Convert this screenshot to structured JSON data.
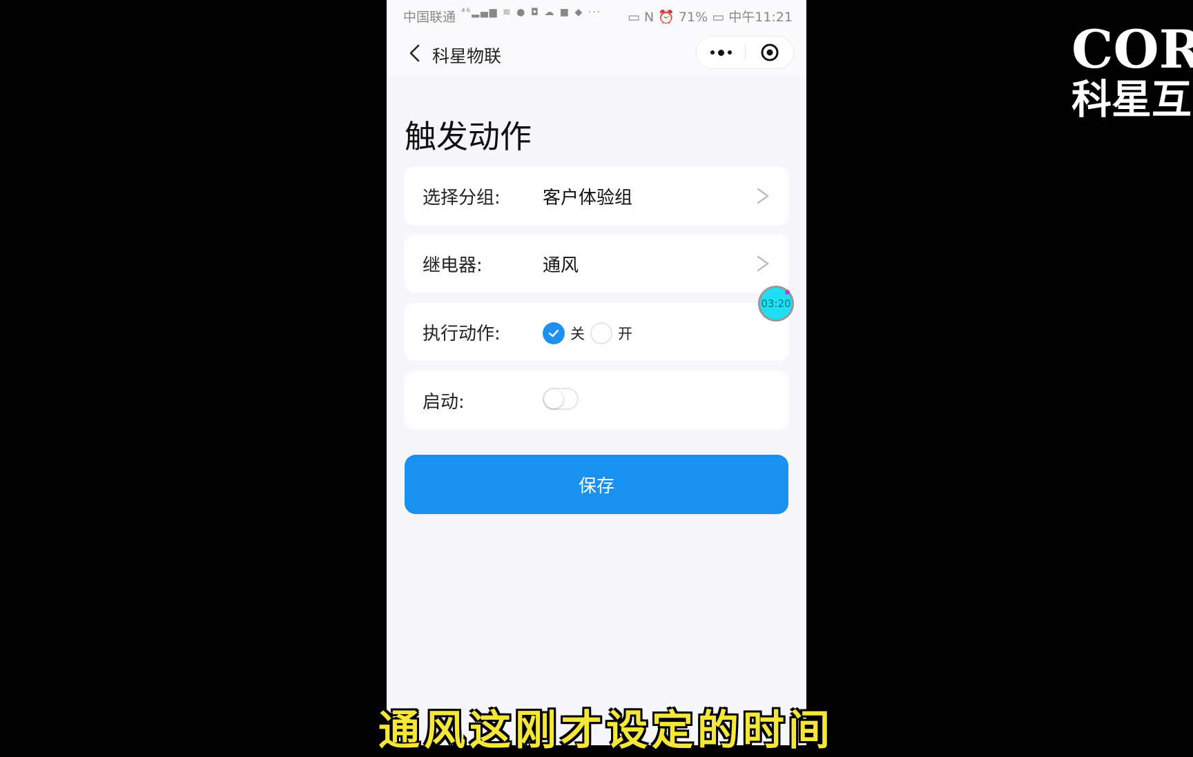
{
  "status_bar": {
    "carrier": "中国联通",
    "icons": "⁴⁶▂▄▆ ≋ ● ◘ ☁ ■ ◆ ···",
    "right": "▭ N ⏰ 71% ▭ 中午11:21"
  },
  "nav": {
    "title": "科星物联"
  },
  "page": {
    "title": "触发动作"
  },
  "form": {
    "group_label": "选择分组:",
    "group_value": "客户体验组",
    "relay_label": "继电器:",
    "relay_value": "通风",
    "action_label": "执行动作:",
    "action_options": [
      "关",
      "开"
    ],
    "action_selected": "关",
    "enable_label": "启动:",
    "enable_on": false
  },
  "save_label": "保存",
  "timer": "03:20",
  "video_subtitle": "通风这刚才设定的时间",
  "logo": {
    "top": "COR",
    "bottom": "科星互"
  },
  "colors": {
    "accent": "#1a90ef",
    "subtitle": "#f5e63a"
  }
}
